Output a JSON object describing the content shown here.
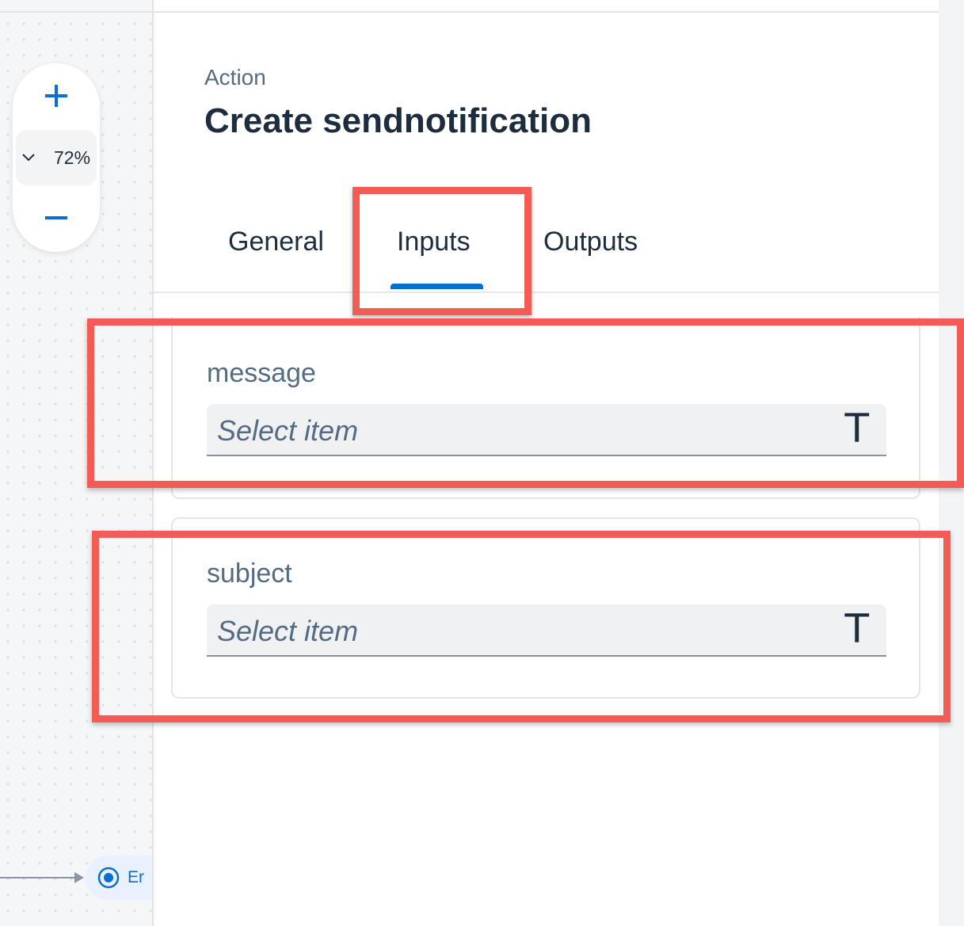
{
  "canvas": {
    "zoom_level": "72%",
    "end_node_label": "Er"
  },
  "panel": {
    "kicker": "Action",
    "title": "Create sendnotification",
    "tabs": [
      {
        "label": "General",
        "active": false
      },
      {
        "label": "Inputs",
        "active": true
      },
      {
        "label": "Outputs",
        "active": false
      }
    ],
    "inputs": [
      {
        "label": "message",
        "placeholder": "Select item",
        "type_glyph": "T"
      },
      {
        "label": "subject",
        "placeholder": "Select item",
        "type_glyph": "T"
      }
    ]
  },
  "colors": {
    "accent": "#0a6ed1",
    "highlight": "#f25c54",
    "text_dark": "#1d2d3e",
    "text_muted": "#556b82"
  },
  "icons": {
    "zoom_in": "plus-icon",
    "zoom_out": "minus-icon",
    "zoom_dropdown": "chevron-down-icon",
    "end_node": "radio-target-icon"
  }
}
